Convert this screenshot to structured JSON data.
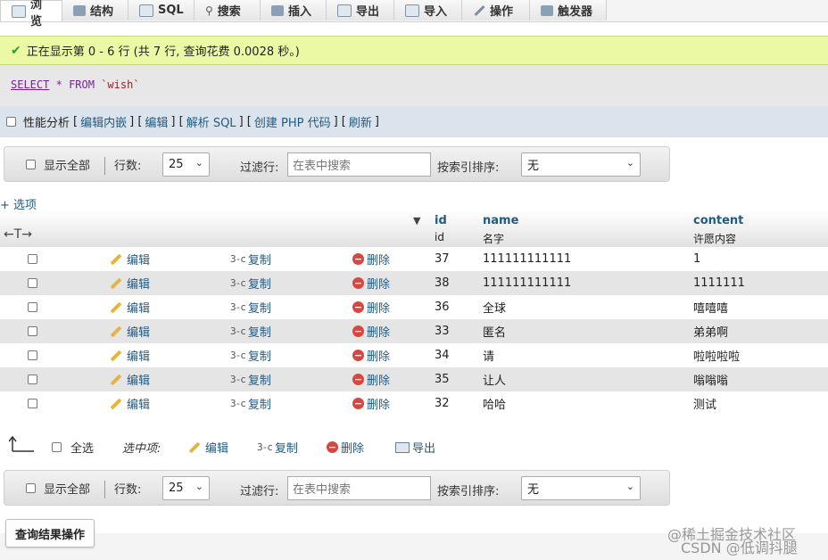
{
  "tabs": [
    {
      "label": "浏览",
      "icon": "browse-icon",
      "active": true
    },
    {
      "label": "结构",
      "icon": "structure-icon"
    },
    {
      "label": "SQL",
      "icon": "sql-icon"
    },
    {
      "label": "搜索",
      "icon": "search-icon"
    },
    {
      "label": "插入",
      "icon": "insert-icon"
    },
    {
      "label": "导出",
      "icon": "export-icon"
    },
    {
      "label": "导入",
      "icon": "import-icon"
    },
    {
      "label": "操作",
      "icon": "wrench-icon"
    },
    {
      "label": "触发器",
      "icon": "trigger-icon"
    }
  ],
  "success_message": "正在显示第 0 - 6 行 (共 7 行, 查询花费 0.0028 秒。)",
  "sql": {
    "select": "SELECT",
    "star": "*",
    "from": "FROM",
    "table": "`wish`"
  },
  "profiling": {
    "label": "性能分析",
    "open_bracket": "[",
    "edit_inline": "编辑内嵌",
    "edit": "编辑",
    "explain": "解析 SQL",
    "create_php": "创建 PHP 代码",
    "refresh": "刷新",
    "close_bracket": "]",
    "separator": "] ["
  },
  "nav": {
    "show_all": "显示全部",
    "rows_label": "行数:",
    "rows_value": "25",
    "filter_label": "过滤行:",
    "filter_placeholder": "在表中搜索",
    "sort_label": "按索引排序:",
    "sort_value": "无"
  },
  "options_link": "+ 选项",
  "columns": [
    {
      "name": "id",
      "comment": "id"
    },
    {
      "name": "name",
      "comment": "名字"
    },
    {
      "name": "content",
      "comment": "许愿内容"
    }
  ],
  "row_actions": {
    "edit": "编辑",
    "copy": "复制",
    "delete": "删除"
  },
  "rows": [
    {
      "id": "37",
      "name": "111111111111",
      "content": "1"
    },
    {
      "id": "38",
      "name": "111111111111",
      "content": "1111111"
    },
    {
      "id": "36",
      "name": "全球",
      "content": "嘻嘻嘻"
    },
    {
      "id": "33",
      "name": "匿名",
      "content": "弟弟啊"
    },
    {
      "id": "34",
      "name": "请",
      "content": "啦啦啦啦"
    },
    {
      "id": "35",
      "name": "让人",
      "content": "嗡嗡嗡"
    },
    {
      "id": "32",
      "name": "哈哈",
      "content": "测试"
    }
  ],
  "bulk": {
    "select_all": "全选",
    "with_selected": "选中项:",
    "edit": "编辑",
    "copy": "复制",
    "delete": "删除",
    "export": "导出"
  },
  "query_ops_button": "查询结果操作",
  "watermark": {
    "line1": "@稀土掘金技术社区",
    "line2": "CSDN @低调抖腿"
  },
  "colors": {
    "success_bg": "#ebf8a4",
    "link": "#235a81",
    "row_alt": "#e5e5e5",
    "delete": "#d9463f"
  }
}
